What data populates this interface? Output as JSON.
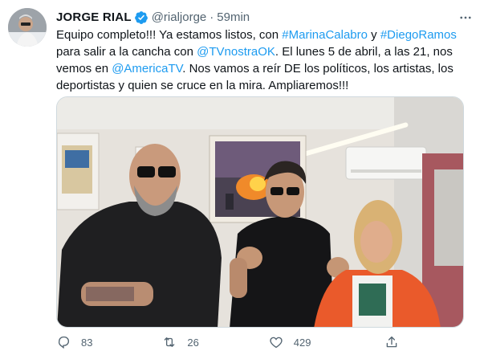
{
  "tweet": {
    "author_name": "JORGE RIAL",
    "handle": "@rialjorge",
    "separator": "·",
    "time": "59min",
    "text_parts": [
      {
        "text": "Equipo completo!!! Ya estamos listos, con ",
        "link": false
      },
      {
        "text": "#MarinaCalabro",
        "link": true
      },
      {
        "text": " y ",
        "link": false
      },
      {
        "text": "#DiegoRamos",
        "link": true
      },
      {
        "text": " para salir a la cancha con ",
        "link": false
      },
      {
        "text": "@TVnostraOK",
        "link": true
      },
      {
        "text": ". El lunes 5 de abril, a las 21, nos vemos en ",
        "link": false
      },
      {
        "text": "@AmericaTV",
        "link": true
      },
      {
        "text": ". Nos vamos a reír DE los políticos, los artistas, los deportistas y quien se cruce en la mira.  Ampliaremos!!!",
        "link": false
      }
    ],
    "actions": {
      "replies": "83",
      "retweets": "26",
      "likes": "429",
      "share": ""
    }
  },
  "colors": {
    "link": "#1d9bf0",
    "secondary_text": "#536471",
    "verified": "#1d9bf0"
  },
  "icons": {
    "verified": "verified-badge-icon",
    "more": "more-dots-icon",
    "reply": "reply-icon",
    "retweet": "retweet-icon",
    "like": "heart-icon",
    "share": "share-icon"
  }
}
